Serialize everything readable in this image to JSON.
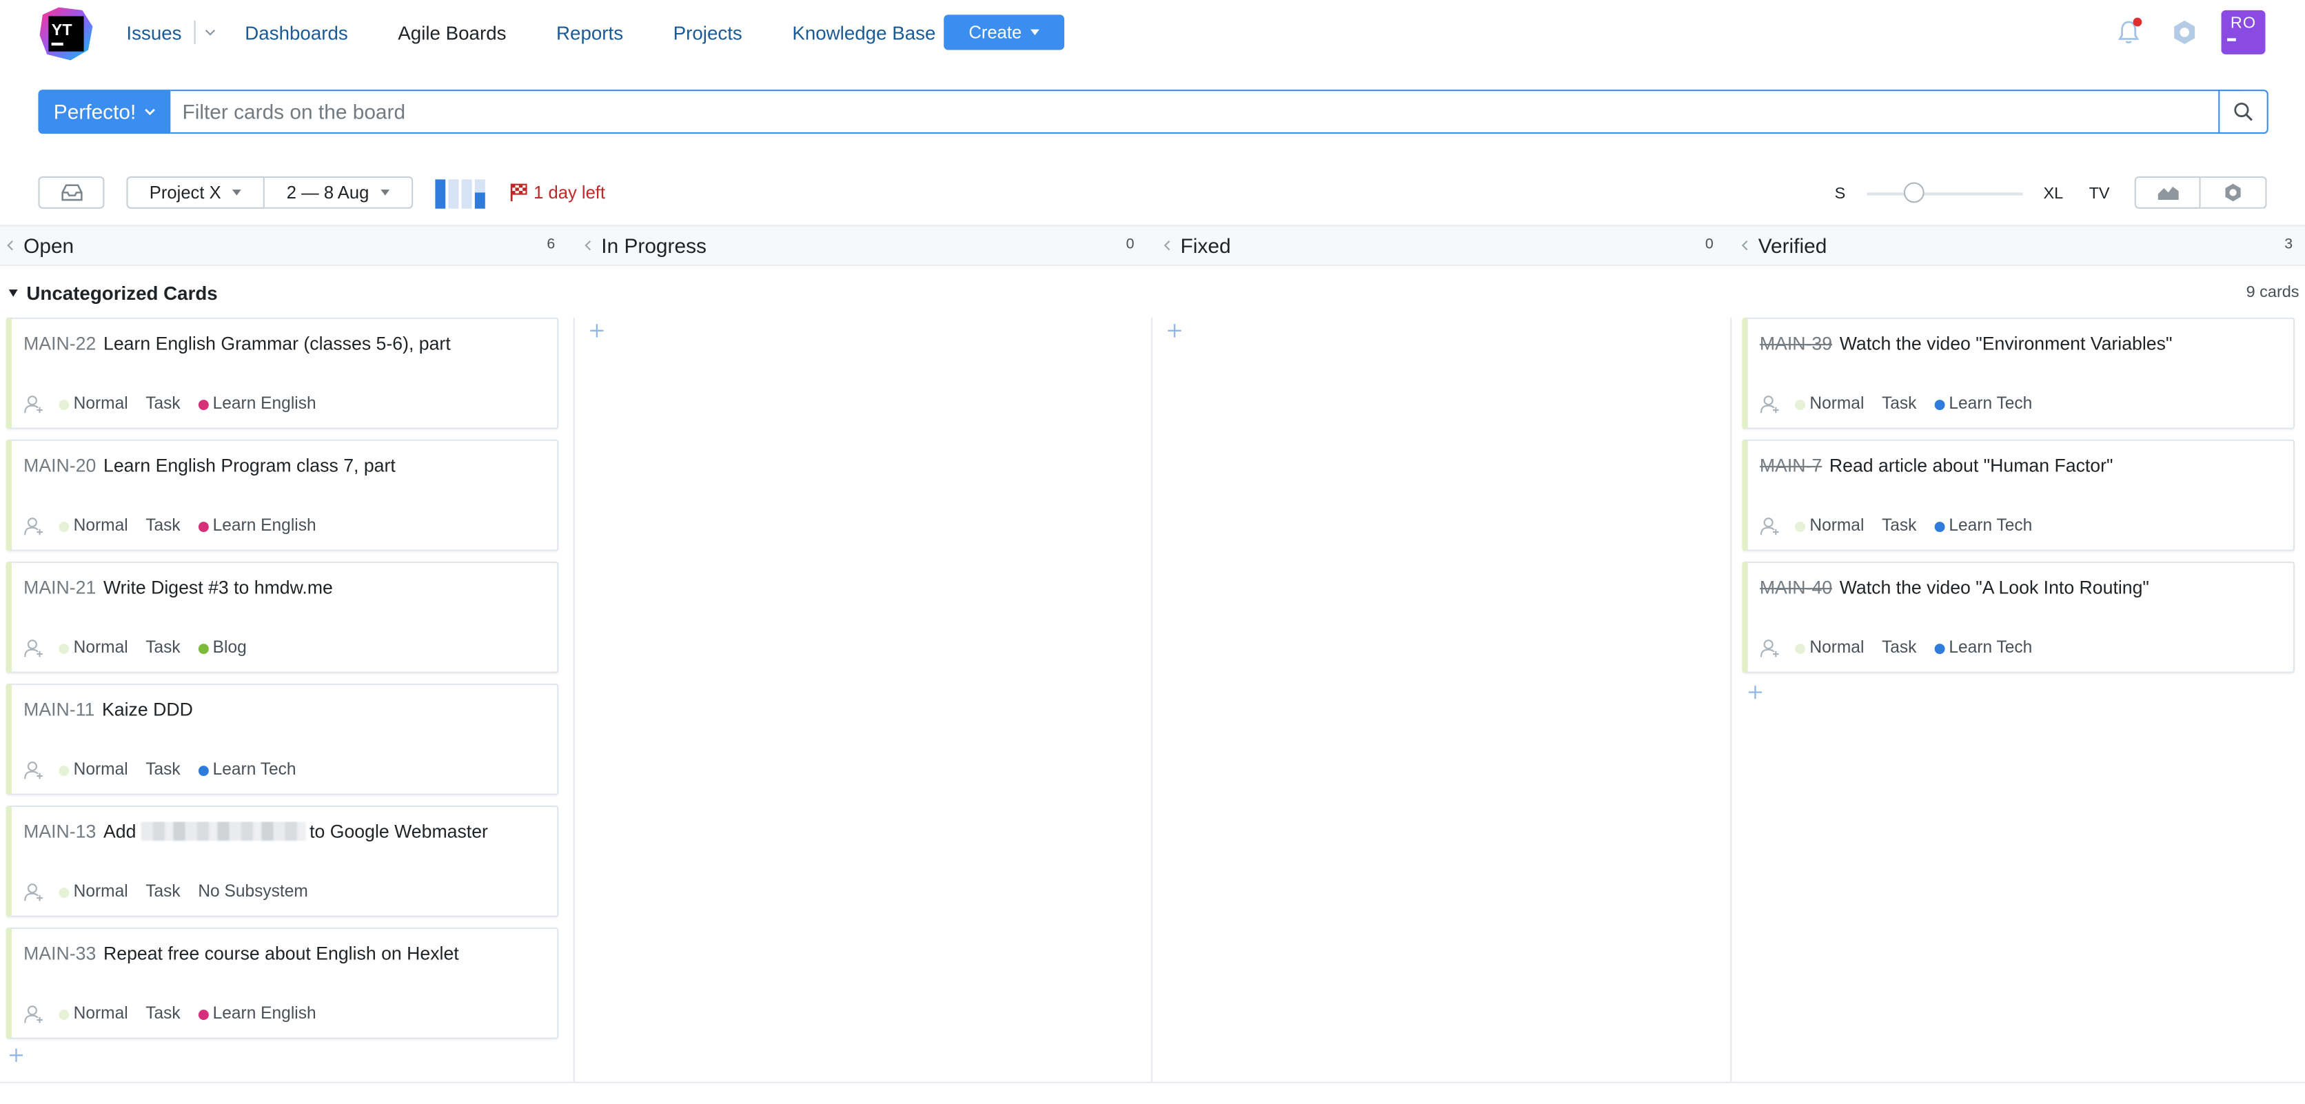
{
  "header": {
    "logo_text": "YT",
    "nav": {
      "issues": "Issues",
      "dashboards": "Dashboards",
      "agile_boards": "Agile Boards",
      "reports": "Reports",
      "projects": "Projects",
      "knowledge_base": "Knowledge Base"
    },
    "create_label": "Create",
    "avatar_initials": "RO"
  },
  "search": {
    "board_name": "Perfecto!",
    "placeholder": "Filter cards on the board"
  },
  "toolbar": {
    "project": "Project X",
    "sprint": "2 — 8 Aug",
    "warning": "1 day left",
    "size_s": "S",
    "size_xl": "XL",
    "size_tv": "TV",
    "card_size_level": 0.3
  },
  "columns": [
    {
      "name": "Open",
      "count": "6"
    },
    {
      "name": "In Progress",
      "count": "0"
    },
    {
      "name": "Fixed",
      "count": "0"
    },
    {
      "name": "Verified",
      "count": "3"
    }
  ],
  "swimlane": {
    "title": "Uncategorized Cards",
    "count": "9 cards"
  },
  "colors": {
    "accent": "#3c8df0",
    "link": "#1a5a96",
    "avatar": "#8a4be3",
    "learn_english": "#d6307a",
    "learn_tech": "#2f7bdc",
    "blog": "#7dba3c",
    "priority_normal": "#e6f2d6",
    "warning": "#c22727"
  },
  "open_cards": [
    {
      "id": "MAIN-22",
      "summary": "Learn English Grammar (classes 5-6), part",
      "priority": "Normal",
      "type": "Task",
      "subsystem": "Learn English",
      "subsystem_color": "#d6307a"
    },
    {
      "id": "MAIN-20",
      "summary": "Learn English Program class 7, part",
      "priority": "Normal",
      "type": "Task",
      "subsystem": "Learn English",
      "subsystem_color": "#d6307a"
    },
    {
      "id": "MAIN-21",
      "summary": "Write Digest #3 to hmdw.me",
      "priority": "Normal",
      "type": "Task",
      "subsystem": "Blog",
      "subsystem_color": "#7dba3c"
    },
    {
      "id": "MAIN-11",
      "summary": "Kaize DDD",
      "priority": "Normal",
      "type": "Task",
      "subsystem": "Learn Tech",
      "subsystem_color": "#2f7bdc"
    },
    {
      "id": "MAIN-13",
      "summary_before": "Add",
      "summary_after": "to Google Webmaster",
      "priority": "Normal",
      "type": "Task",
      "subsystem": "No Subsystem",
      "subsystem_color": ""
    },
    {
      "id": "MAIN-33",
      "summary": "Repeat free course about English on Hexlet",
      "priority": "Normal",
      "type": "Task",
      "subsystem": "Learn English",
      "subsystem_color": "#d6307a"
    }
  ],
  "verified_cards": [
    {
      "id": "MAIN-39",
      "summary": "Watch the video \"Environment Variables\"",
      "priority": "Normal",
      "type": "Task",
      "subsystem": "Learn Tech",
      "subsystem_color": "#2f7bdc"
    },
    {
      "id": "MAIN-7",
      "summary": "Read article about \"Human Factor\"",
      "priority": "Normal",
      "type": "Task",
      "subsystem": "Learn Tech",
      "subsystem_color": "#2f7bdc"
    },
    {
      "id": "MAIN-40",
      "summary": "Watch the video \"A Look Into Routing\"",
      "priority": "Normal",
      "type": "Task",
      "subsystem": "Learn Tech",
      "subsystem_color": "#2f7bdc"
    }
  ]
}
